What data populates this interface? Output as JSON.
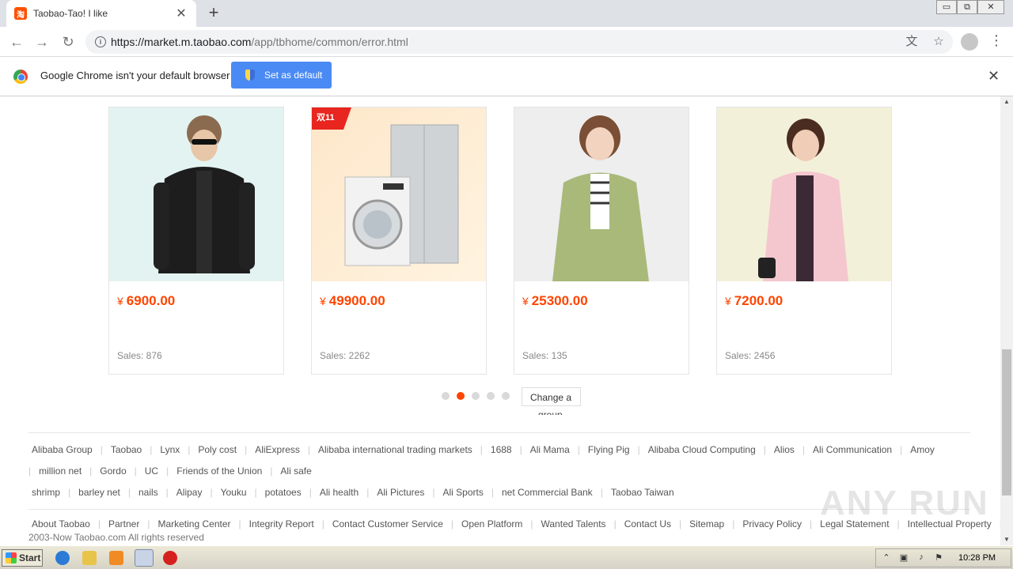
{
  "browser": {
    "tab_title": "Taobao-Tao! I like",
    "tab_favicon_text": "淘",
    "url_host": "https://market.m.taobao.com",
    "url_path": "/app/tbhome/common/error.html",
    "window_controls": [
      "▭",
      "⧉",
      "✕"
    ]
  },
  "infobar": {
    "message": "Google Chrome isn't your default browser",
    "button_label": "Set as default"
  },
  "products": [
    {
      "currency": "¥",
      "price": "6900.00",
      "sales": "Sales: 876",
      "badge": ""
    },
    {
      "currency": "¥",
      "price": "49900.00",
      "sales": "Sales: 2262",
      "badge": "双11"
    },
    {
      "currency": "¥",
      "price": "25300.00",
      "sales": "Sales: 135",
      "badge": ""
    },
    {
      "currency": "¥",
      "price": "7200.00",
      "sales": "Sales: 2456",
      "badge": ""
    }
  ],
  "carousel": {
    "dot_count": 5,
    "active_index": 1,
    "change_label": "Change a",
    "change_label_overflow": "group"
  },
  "footer": {
    "row1": [
      "Alibaba Group",
      "Taobao",
      "Lynx",
      "Poly cost",
      "AliExpress",
      "Alibaba international trading markets",
      "1688",
      "Ali Mama",
      "Flying Pig",
      "Alibaba Cloud Computing",
      "Alios",
      "Ali Communication",
      "Amoy"
    ],
    "row2": [
      "million net",
      "Gordo",
      "UC",
      "Friends of the Union",
      "Ali safe"
    ],
    "row3": [
      "shrimp",
      "barley net",
      "nails",
      "Alipay",
      "Youku",
      "potatoes",
      "Ali health",
      "Ali Pictures",
      "Ali Sports",
      "net Commercial Bank",
      "Taobao Taiwan"
    ],
    "row4": [
      "About Taobao",
      "Partner",
      "Marketing Center",
      "Integrity Report",
      "Contact Customer Service",
      "Open Platform",
      "Wanted Talents",
      "Contact Us",
      "Sitemap",
      "Privacy Policy",
      "Legal Statement",
      "Intellectual Property",
      "©"
    ],
    "copyright": "2003-Now Taobao.com All rights reserved"
  },
  "watermark": "ANY RUN",
  "taskbar": {
    "start_label": "Start",
    "clock": "10:28 PM"
  },
  "colors": {
    "accent": "#ff4400",
    "chrome_blue": "#4a8af4"
  }
}
